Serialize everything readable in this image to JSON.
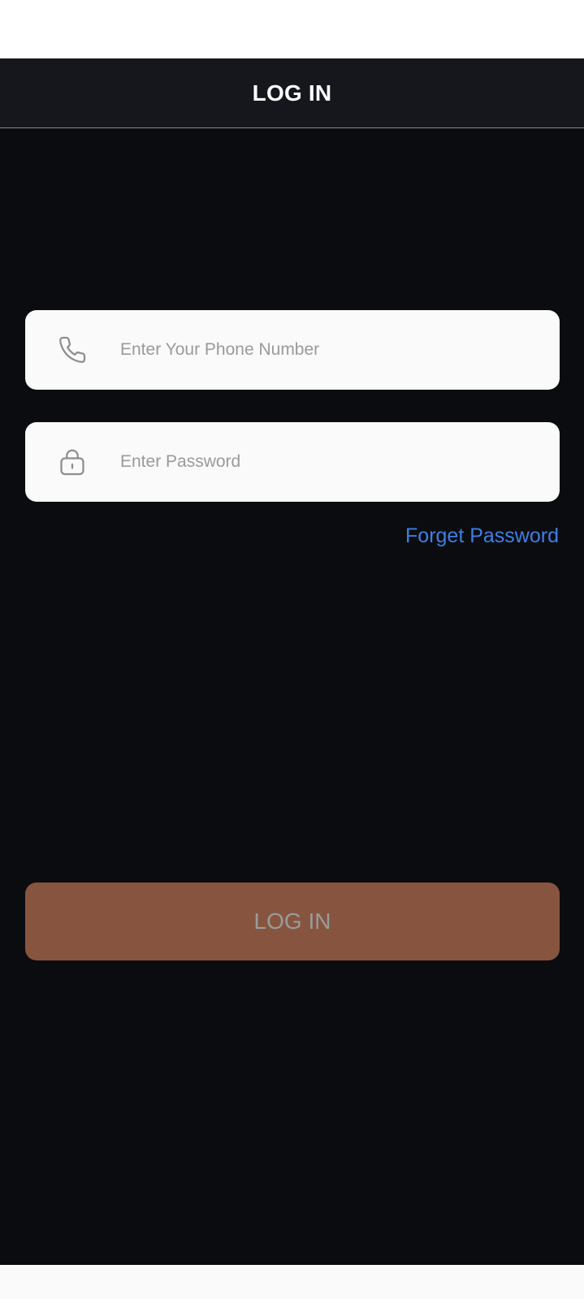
{
  "header": {
    "title": "LOG IN"
  },
  "form": {
    "phone": {
      "placeholder": "Enter Your Phone Number",
      "value": "",
      "icon": "phone-icon"
    },
    "password": {
      "placeholder": "Enter Password",
      "value": "",
      "icon": "lock-icon"
    },
    "forgot_label": "Forget Password",
    "submit_label": "LOG IN"
  },
  "colors": {
    "background": "#0b0c10",
    "header": "#16171c",
    "field": "#fafafa",
    "link": "#3d7fe6",
    "button": "#87553f",
    "button_text": "#9b9b9b"
  }
}
